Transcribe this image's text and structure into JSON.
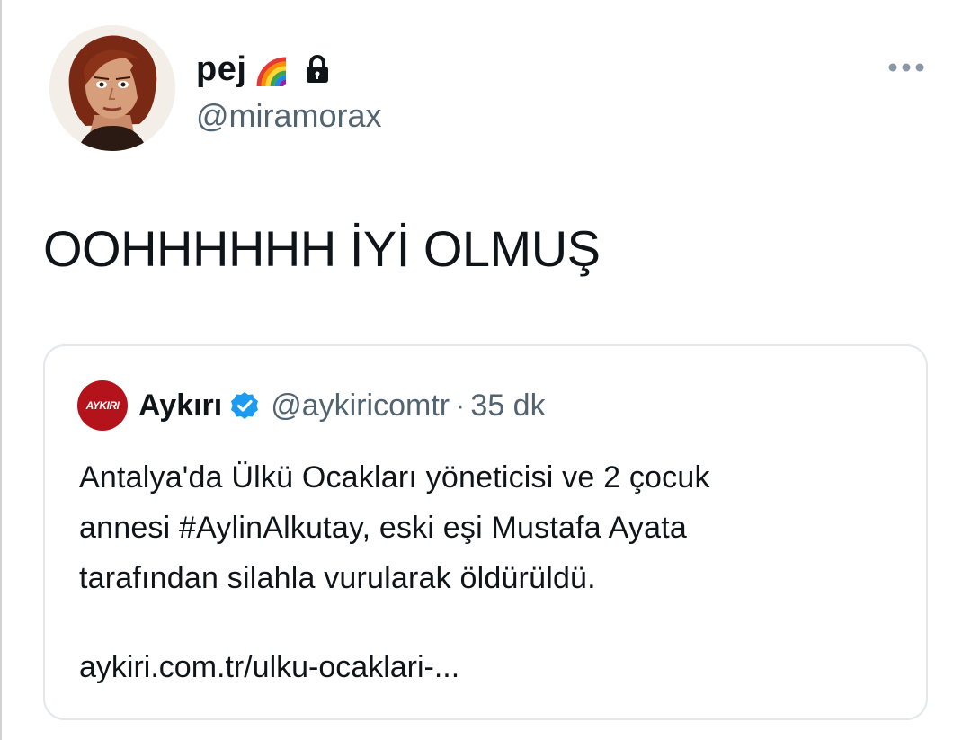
{
  "tweet": {
    "author": {
      "display_name": "pej",
      "handle": "@miramorax",
      "badges": [
        "rainbow-icon",
        "lock-icon"
      ]
    },
    "more_icon": "more-horizontal-icon",
    "text": "OOHHHHHH İYİ OLMUŞ"
  },
  "quoted_tweet": {
    "author": {
      "avatar_text": "AYKIRI",
      "display_name": "Aykırı",
      "verified": true,
      "handle": "@aykiricomtr",
      "separator": "·",
      "time": "35 dk"
    },
    "body_lines": [
      "Antalya'da Ülkü Ocakları yöneticisi ve 2 çocuk",
      "annesi #AylinAlkutay, eski eşi Mustafa Ayata",
      "tarafından silahla vurularak öldürüldü."
    ],
    "link": "aykiri.com.tr/ulku-ocaklari-..."
  },
  "colors": {
    "text": "#0f1419",
    "secondary": "#536471",
    "border": "#e3e7ea",
    "verified": "#1d9bf0",
    "brand_red": "#b4131b"
  }
}
